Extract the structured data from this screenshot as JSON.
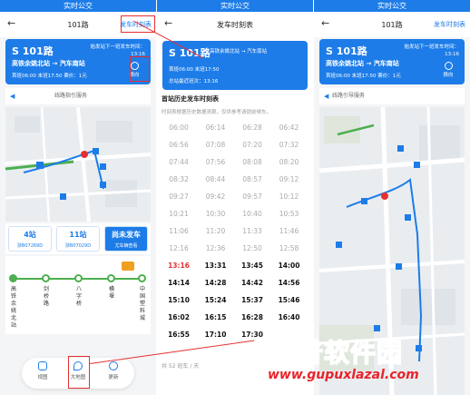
{
  "screens": [
    {
      "status_title": "实时公交",
      "nav": {
        "back": "←",
        "title": "101路",
        "timetable_link": "发车时刻表"
      },
      "card": {
        "route": "101路",
        "wait": "始发站下一班发车时间：",
        "wait_time": "13:16",
        "origin": "高铁余姚北站",
        "arrow": "→",
        "destination": "汽车南站",
        "first_bus": "首班06:00",
        "last_bus": "末班17:50",
        "fare": "票价：1元",
        "swap": "换向"
      },
      "notice": "线路指引服务",
      "stats": [
        {
          "value": "4站",
          "label": "浙B07269D"
        },
        {
          "value": "11站",
          "label": "浙B07029D"
        },
        {
          "value": "尚未发车",
          "label": "尤车辆查看"
        }
      ],
      "stops": [
        "高铁余姚北站",
        "剑桥路",
        "八字桥",
        "横堰",
        "中国塑料城"
      ],
      "bottom_nav": [
        {
          "label": "视图",
          "icon": "list-icon"
        },
        {
          "label": "大地图",
          "icon": "map-pin-icon"
        },
        {
          "label": "更新",
          "icon": "refresh-icon"
        }
      ]
    },
    {
      "status_title": "实时公交",
      "nav": {
        "back": "←",
        "title": "发车时刻表"
      },
      "card": {
        "route": "101路",
        "origin": "高铁余姚北站",
        "arrow": "→",
        "destination": "汽车南站",
        "first_bus": "首班06:00",
        "last_bus": "末班17:50",
        "interval": "总站最近班次：13:16"
      },
      "section_title": "首站历史发车时刻表",
      "note": "时刻表根据历史数据测算，仅供参考请提前候车。",
      "timetable": [
        [
          "06:00",
          "06:14",
          "06:28",
          "06:42"
        ],
        [
          "06:56",
          "07:08",
          "07:20",
          "07:32"
        ],
        [
          "07:44",
          "07:56",
          "08:08",
          "08:20"
        ],
        [
          "08:32",
          "08:44",
          "08:57",
          "09:12"
        ],
        [
          "09:27",
          "09:42",
          "09:57",
          "10:12"
        ],
        [
          "10:21",
          "10:30",
          "10:40",
          "10:53"
        ],
        [
          "11:06",
          "11:20",
          "11:33",
          "11:46"
        ],
        [
          "12:16",
          "12:36",
          "12:50",
          "12:58"
        ],
        [
          "13:16",
          "13:31",
          "13:45",
          "14:00"
        ],
        [
          "14:14",
          "14:28",
          "14:42",
          "14:56"
        ],
        [
          "15:10",
          "15:24",
          "15:37",
          "15:46"
        ],
        [
          "16:02",
          "16:15",
          "16:28",
          "16:40"
        ],
        [
          "16:55",
          "17:10",
          "17:30",
          ""
        ]
      ],
      "current_time": "13:16",
      "footer": "共 52 班车 / 天"
    },
    {
      "status_title": "实时公交",
      "nav": {
        "back": "←",
        "title": "101路",
        "timetable_link": "发车时刻表"
      },
      "card": {
        "route": "101路",
        "wait": "始发站下一班发车时间：",
        "wait_time": "13:16",
        "origin": "高铁余姚北站",
        "arrow": "→",
        "destination": "汽车南站",
        "first_bus": "首班06:00",
        "last_bus": "末班17:50",
        "fare": "票价：1元",
        "swap": "换向"
      },
      "notice": "线路引导服务"
    }
  ],
  "watermark": {
    "text": "谷普软件园",
    "url": "www.gupuxlazal.com"
  },
  "colors": {
    "primary": "#1d7ce8",
    "highlight": "#e63030",
    "route_line": "#4caf50"
  }
}
